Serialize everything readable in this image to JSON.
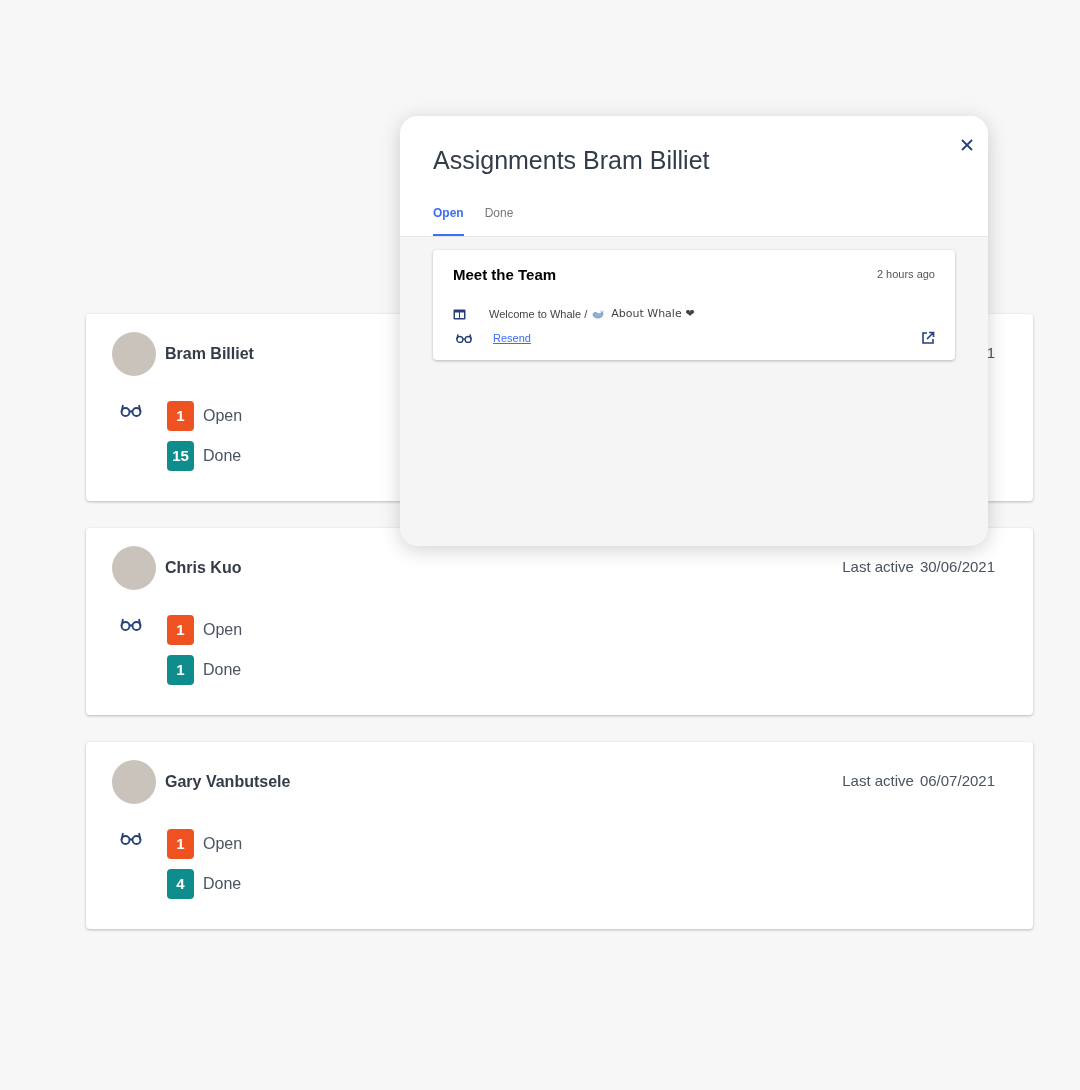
{
  "members": [
    {
      "name": "Bram Billiet",
      "last_active": "1",
      "counts": [
        {
          "kind": "open",
          "count": "1",
          "label": "Open"
        },
        {
          "kind": "done",
          "count": "15",
          "label": "Done"
        }
      ]
    },
    {
      "name": "Chris Kuo",
      "last_active_label": "Last active",
      "last_active": "30/06/2021",
      "counts": [
        {
          "kind": "open",
          "count": "1",
          "label": "Open"
        },
        {
          "kind": "done",
          "count": "1",
          "label": "Done"
        }
      ]
    },
    {
      "name": "Gary Vanbutsele",
      "last_active_label": "Last active",
      "last_active": "06/07/2021",
      "counts": [
        {
          "kind": "open",
          "count": "1",
          "label": "Open"
        },
        {
          "kind": "done",
          "count": "4",
          "label": "Done"
        }
      ]
    }
  ],
  "dialog": {
    "title": "Assignments Bram Billiet",
    "tabs": [
      {
        "label": "Open",
        "selected": true
      },
      {
        "label": "Done",
        "selected": false
      }
    ],
    "assignments": [
      {
        "title": "Meet the Team",
        "time": "2 hours ago",
        "path_start": "Welcome to Whale /",
        "path_end": "About Whale ❤",
        "link": "Resend"
      }
    ]
  }
}
